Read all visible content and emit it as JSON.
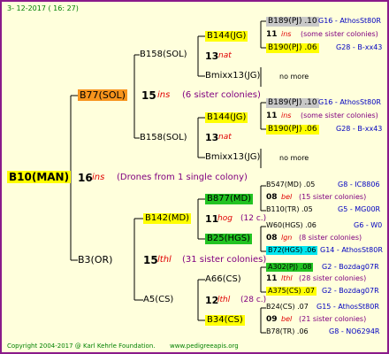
{
  "header": {
    "date": "3- 12-2017 ( 16: 27)"
  },
  "footer": {
    "copyright": "Copyright 2004-2017 @ Karl Kehrle Foundation.",
    "url": "www.pedigreeapis.org"
  },
  "colors": {
    "border": "#8a1a8a",
    "background": "#ffffdc"
  },
  "root": {
    "label": "B10(MAN)",
    "num": "16",
    "mark": "ins",
    "note": "(Drones from 1 single colony)"
  },
  "upper": {
    "label": "B77(SOL)",
    "num": "15",
    "mark": "ins",
    "note": "(6 sister colonies)",
    "ga": {
      "label": "B158(SOL)",
      "gg1": {
        "label": "B144(JG)",
        "num": "13",
        "mark": "nat",
        "top": {
          "label": "B189(PJ) .10",
          "right": "G16 - AthosSt80R"
        },
        "mid": {
          "num": "11",
          "mark": "ins",
          "note": "(some sister colonies)"
        },
        "bot": {
          "label": "B190(PJ) .06",
          "right": "G28 - B-xx43"
        }
      },
      "gg2": {
        "label": "Bmixx13(JG)",
        "note": "no more"
      }
    },
    "gb": {
      "label": "B158(SOL)",
      "gg1": {
        "label": "B144(JG)",
        "num": "13",
        "mark": "nat",
        "top": {
          "label": "B189(PJ) .10",
          "right": "G16 - AthosSt80R"
        },
        "mid": {
          "num": "11",
          "mark": "ins",
          "note": "(some sister colonies)"
        },
        "bot": {
          "label": "B190(PJ) .06",
          "right": "G28 - B-xx43"
        }
      },
      "gg2": {
        "label": "Bmixx13(JG)",
        "note": "no more"
      }
    }
  },
  "lower": {
    "label": "B3(OR)",
    "num": "15",
    "mark": "lthl",
    "note": "(31 sister colonies)",
    "ga": {
      "label": "B142(MD)",
      "num": "11",
      "mark": "hog",
      "note": "(12 c.)",
      "gg1": {
        "label": "B877(MD)",
        "num": "08",
        "mark": "bel",
        "note": "(15 sister colonies)",
        "top": {
          "label": "B547(MD) .05",
          "right": "G8 - IC8806"
        },
        "bot": {
          "label": "B110(TR) .05",
          "right": "G5 - MG00R"
        }
      },
      "gg2": {
        "label": "B25(HGS)",
        "num": "08",
        "mark": "lgn",
        "note": "(8 sister colonies)",
        "top": {
          "label": "W60(HGS) .06",
          "right": "G6 - W0"
        },
        "bot": {
          "label": "B72(HGS) .06",
          "right": "G14 - AthosSt80R"
        }
      }
    },
    "gb": {
      "label": "A5(CS)",
      "num": "12",
      "mark": "lthl",
      "note": "(28 c.)",
      "gg1": {
        "label": "A66(CS)",
        "num": "11",
        "mark": "lthl",
        "note": "(28 sister colonies)",
        "top": {
          "label": "A302(PJ) .08",
          "right": "G2 - Bozdag07R"
        },
        "bot": {
          "label": "A375(CS) .07",
          "right": "G2 - Bozdag07R"
        }
      },
      "gg2": {
        "label": "B34(CS)",
        "num": "09",
        "mark": "bel",
        "note": "(21 sister colonies)",
        "top": {
          "label": "B24(CS) .07",
          "right": "G15 - AthosSt80R"
        },
        "bot": {
          "label": "B78(TR) .06",
          "right": "G8 - NO6294R"
        }
      }
    }
  }
}
